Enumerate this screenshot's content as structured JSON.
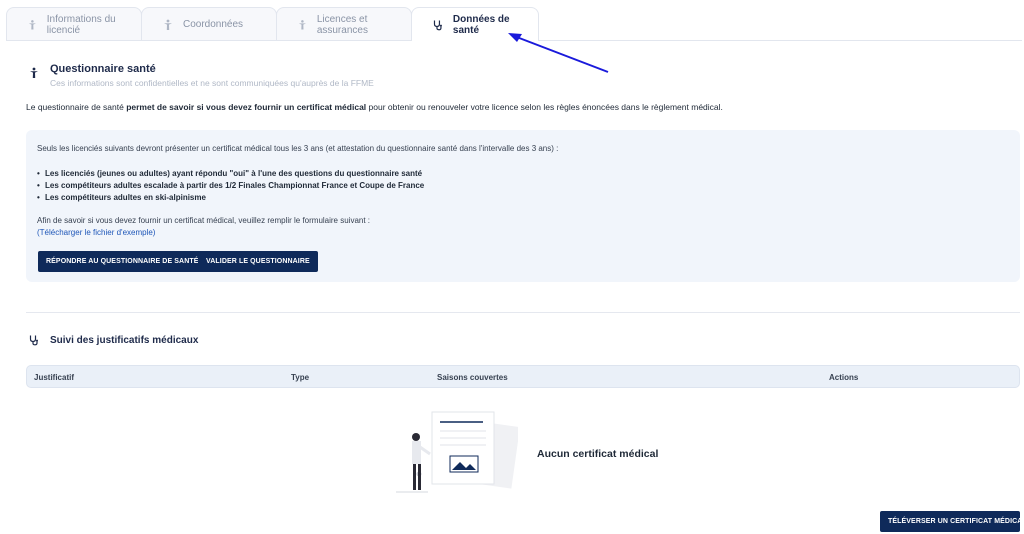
{
  "tabs": [
    {
      "label": "Informations du licencié",
      "icon": "person-icon"
    },
    {
      "label": "Coordonnées",
      "icon": "person-icon"
    },
    {
      "label": "Licences et assurances",
      "icon": "person-icon"
    },
    {
      "label": "Données de santé",
      "icon": "stethoscope-icon",
      "active": true
    }
  ],
  "questionnaire": {
    "title": "Questionnaire santé",
    "subtitle": "Ces informations sont confidentielles et ne sont communiquées qu'auprès de la FFME",
    "intro_before": "Le questionnaire de santé ",
    "intro_bold": "permet de savoir si vous devez fournir un certificat médical",
    "intro_after": " pour obtenir ou renouveler votre licence selon les règles énoncées dans le règlement médical.",
    "box_line1": "Seuls les licenciés suivants devront présenter un certificat médical tous les 3 ans (et attestation du questionnaire santé dans l'intervalle des 3 ans) :",
    "bullets": [
      "Les licenciés (jeunes ou adultes) ayant répondu \"oui\" à l'une des questions du questionnaire santé",
      "Les compétiteurs adultes escalade à partir des 1/2 Finales Championnat France et Coupe de France",
      "Les compétiteurs adultes en ski-alpinisme"
    ],
    "box_line2": "Afin de savoir si vous devez fournir un certificat médical, veuillez remplir le formulaire suivant :",
    "download_link": "(Télécharger le fichier d'exemple)",
    "btn_answer": "RÉPONDRE AU QUESTIONNAIRE DE SANTÉ",
    "btn_validate": "VALIDER LE QUESTIONNAIRE"
  },
  "medical": {
    "title": "Suivi des justificatifs médicaux",
    "columns": [
      "Justificatif",
      "Type",
      "Saisons couvertes",
      "Actions"
    ],
    "empty_text": "Aucun certificat médical",
    "upload_btn": "TÉLÉVERSER UN CERTIFICAT MÉDICAL"
  },
  "colors": {
    "primary": "#0f2a5a",
    "link": "#1e56b8",
    "annotation_arrow": "#1a1adb"
  }
}
